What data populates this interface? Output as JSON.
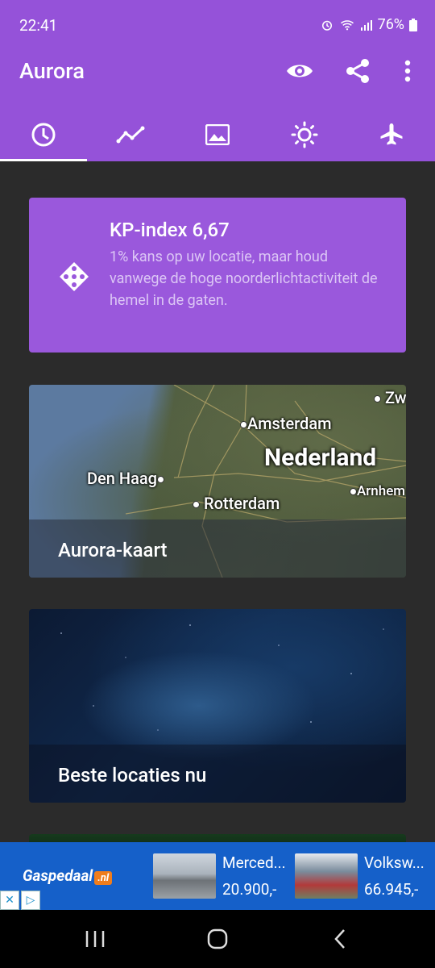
{
  "status_bar": {
    "time": "22:41",
    "battery": "76%"
  },
  "app_bar": {
    "title": "Aurora"
  },
  "tabs": [
    {
      "icon": "clock-icon",
      "active": true
    },
    {
      "icon": "trend-icon",
      "active": false
    },
    {
      "icon": "image-icon",
      "active": false
    },
    {
      "icon": "sun-icon",
      "active": false
    },
    {
      "icon": "airplane-icon",
      "active": false
    }
  ],
  "kp_card": {
    "title": "KP-index 6,67",
    "text": "1% kans op uw locatie, maar houd vanwege de hoge noorderlichtactiviteit de hemel in de gaten."
  },
  "map_card": {
    "label": "Aurora-kaart",
    "cities": {
      "amsterdam": "Amsterdam",
      "den_haag": "Den Haag",
      "rotterdam": "Rotterdam",
      "arnhem": "Arnhem",
      "zwolle": "Zwo"
    },
    "country": "Nederland"
  },
  "locations_card": {
    "label": "Beste locaties nu"
  },
  "ad": {
    "brand": "Gaspedaal",
    "brand_tld": ".nl",
    "items": [
      {
        "name": "Merced...",
        "price": "20.900,-"
      },
      {
        "name": "Volksw...",
        "price": "66.945,-"
      }
    ]
  },
  "colors": {
    "primary": "#9552d9",
    "card_purple": "#9a58dc",
    "background": "#2b2b2b"
  }
}
